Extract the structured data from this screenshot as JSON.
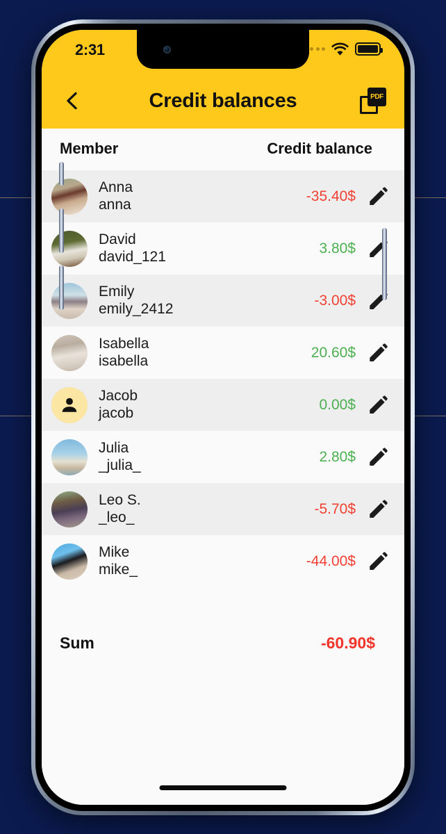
{
  "status_bar": {
    "time": "2:31",
    "cellular_icon": "cellular-dots-icon",
    "wifi_icon": "wifi-icon",
    "battery_icon": "battery-full-icon"
  },
  "nav": {
    "back_icon": "chevron-left-icon",
    "title": "Credit balances",
    "pdf_label": "PDF",
    "pdf_icon": "pdf-export-icon"
  },
  "list_header": {
    "member": "Member",
    "balance": "Credit balance"
  },
  "colors": {
    "accent": "#FFC91C",
    "positive": "#4CAF50",
    "negative": "#F04134",
    "sum_negative": "#F1342A",
    "backdrop": "#0B1B4F",
    "row_alt": "#EEEEEE",
    "row_base": "#FAFAFA",
    "avatar_placeholder": "#FCE6A4"
  },
  "rows": [
    {
      "name": "Anna",
      "handle": "anna",
      "amount": "-35.40$",
      "sign": "neg",
      "avatar": "photo-woman-field",
      "edit_icon": "pencil-icon"
    },
    {
      "name": "David",
      "handle": "david_121",
      "amount": "3.80$",
      "sign": "pos",
      "avatar": "photo-man-boat",
      "edit_icon": "pencil-icon"
    },
    {
      "name": "Emily",
      "handle": "emily_2412",
      "amount": "-3.00$",
      "sign": "neg",
      "avatar": "photo-woman-beach",
      "edit_icon": "pencil-icon"
    },
    {
      "name": "Isabella",
      "handle": "isabella",
      "amount": "20.60$",
      "sign": "pos",
      "avatar": "photo-woman-white",
      "edit_icon": "pencil-icon"
    },
    {
      "name": "Jacob",
      "handle": "jacob",
      "amount": "0.00$",
      "sign": "pos",
      "avatar": "person-placeholder",
      "edit_icon": "pencil-icon"
    },
    {
      "name": "Julia",
      "handle": "_julia_",
      "amount": "2.80$",
      "sign": "pos",
      "avatar": "photo-woman-jumping",
      "edit_icon": "pencil-icon"
    },
    {
      "name": "Leo S.",
      "handle": "_leo_",
      "amount": "-5.70$",
      "sign": "neg",
      "avatar": "photo-man-hat",
      "edit_icon": "pencil-icon"
    },
    {
      "name": "Mike",
      "handle": "mike_",
      "amount": "-44.00$",
      "sign": "neg",
      "avatar": "photo-man-dog",
      "edit_icon": "pencil-icon"
    }
  ],
  "sum": {
    "label": "Sum",
    "value": "-60.90$"
  }
}
